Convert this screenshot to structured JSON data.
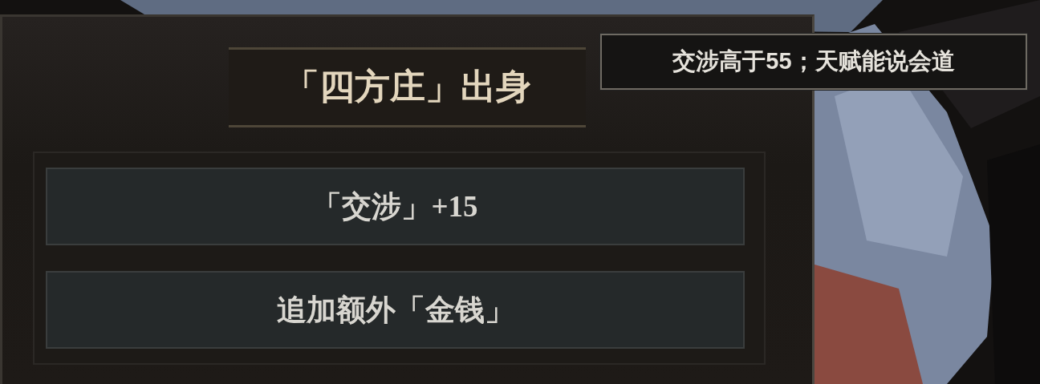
{
  "panel": {
    "title": "「四方庄」出身",
    "effects": [
      {
        "text": "「交涉」+15"
      },
      {
        "text": "追加额外「金钱」"
      }
    ]
  },
  "tooltip": {
    "text": "交涉高于55；天赋能说会道"
  }
}
